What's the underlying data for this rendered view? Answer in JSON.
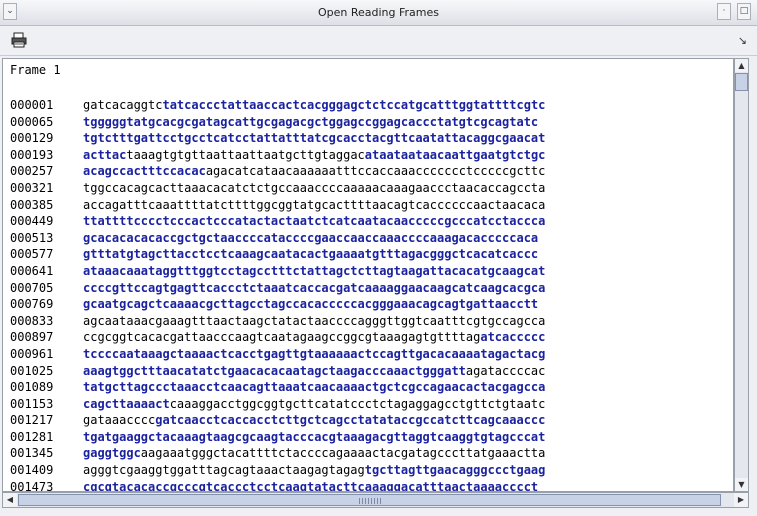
{
  "window": {
    "title": "Open Reading Frames"
  },
  "icons": {
    "print": "printer-icon",
    "corner": "resize-corner-icon"
  },
  "frame_label": "Frame 1",
  "colors": {
    "orf_highlight": "#1a22a0"
  },
  "rows": [
    {
      "pos": "000001",
      "seq": [
        {
          "t": "gatcacaggtc",
          "h": false
        },
        {
          "t": "tatcaccctattaaccactcacgggagctctccatgcatttggtattttcgtc",
          "h": true
        }
      ]
    },
    {
      "pos": "000065",
      "seq": [
        {
          "t": "tgggggtatgcacgcgatagcattgcgagacgctggagccggagcaccctatgtcgcagtatc",
          "h": true
        }
      ]
    },
    {
      "pos": "000129",
      "seq": [
        {
          "t": "tgtctttgattcctgcctcatcctattatttatcgcacctacgttcaatattacaggcgaacat",
          "h": true
        }
      ]
    },
    {
      "pos": "000193",
      "seq": [
        {
          "t": "acttac",
          "h": true
        },
        {
          "t": "taaagtgtgttaattaattaatgcttgtaggac",
          "h": false
        },
        {
          "t": "ataataataacaattgaatgtctgc",
          "h": true
        }
      ]
    },
    {
      "pos": "000257",
      "seq": [
        {
          "t": "acagccactttccacac",
          "h": true
        },
        {
          "t": "agacatcataacaaaaaatttccaccaaaccccccctcccccgcttc",
          "h": false
        }
      ]
    },
    {
      "pos": "000321",
      "seq": [
        {
          "t": "tggccacagcacttaaacacatctctgccaaaccccaaaaacaaagaaccctaacaccagccta",
          "h": false
        }
      ]
    },
    {
      "pos": "000385",
      "seq": [
        {
          "t": "accagatttcaaattttatcttttggcggtatgcacttttaacagtcaccccccaactaacaca",
          "h": false
        }
      ]
    },
    {
      "pos": "000449",
      "seq": [
        {
          "t": "ttattttcccctcccactcccatactactaatctcatcaatacaacccccgcccatcctaccca",
          "h": true
        }
      ]
    },
    {
      "pos": "000513",
      "seq": [
        {
          "t": "gcacacacacaccgctgctaaccccataccccgaaccaaccaaaccccaaagacacccccaca",
          "h": true
        }
      ]
    },
    {
      "pos": "000577",
      "seq": [
        {
          "t": "gtttatgtagcttacctcctcaaagcaatacactgaaaatgtttagacgggctcacatcaccc",
          "h": true
        }
      ]
    },
    {
      "pos": "000641",
      "seq": [
        {
          "t": "ataaacaaataggtttggtcctagcctttctattagctcttagtaagattacacatgcaagcat",
          "h": true
        }
      ]
    },
    {
      "pos": "000705",
      "seq": [
        {
          "t": "ccccgttccagtgagttcaccctctaaatcaccacgatcaaaaggaacaagcatcaagcacgca",
          "h": true
        }
      ]
    },
    {
      "pos": "000769",
      "seq": [
        {
          "t": "gcaatgcagctcaaaacgcttagcctagccacacccccacgggaaacagcagtgattaacctt",
          "h": true
        }
      ]
    },
    {
      "pos": "000833",
      "seq": [
        {
          "t": "agcaataaacgaaagtttaactaagctatactaaccccagggttggtcaatttcgtgccagcca",
          "h": false
        }
      ]
    },
    {
      "pos": "000897",
      "seq": [
        {
          "t": "ccgcggtcacacgattaacccaagtcaatagaagccggcgtaaagagtgttttag",
          "h": false
        },
        {
          "t": "atcaccccc",
          "h": true
        }
      ]
    },
    {
      "pos": "000961",
      "seq": [
        {
          "t": "tccccaataaagctaaaactcacctgagttgtaaaaaactccagttgacacaaaatagactacg",
          "h": true
        }
      ]
    },
    {
      "pos": "001025",
      "seq": [
        {
          "t": "aaagtggctttaacatatctgaacacacaatagctaagacccaaactgggatt",
          "h": true
        },
        {
          "t": "agataccccac",
          "h": false
        }
      ]
    },
    {
      "pos": "001089",
      "seq": [
        {
          "t": "tatgcttagccctaaacctcaacagttaaatcaacaaaactgctcgccagaacactacgagcca",
          "h": true
        }
      ]
    },
    {
      "pos": "001153",
      "seq": [
        {
          "t": "cagcttaaaact",
          "h": true
        },
        {
          "t": "caaaggacctggcggtgcttcatatccctctagaggagcctgttctgtaatc",
          "h": false
        }
      ]
    },
    {
      "pos": "001217",
      "seq": [
        {
          "t": "gataaacccc",
          "h": false
        },
        {
          "t": "gatcaacctcaccacctcttgctcagcctatataccgccatcttcagcaaaccc",
          "h": true
        }
      ]
    },
    {
      "pos": "001281",
      "seq": [
        {
          "t": "tgatgaaggctacaaagtaagcgcaagtacccacgtaaagacgttaggtcaaggtgtagcccat",
          "h": true
        }
      ]
    },
    {
      "pos": "001345",
      "seq": [
        {
          "t": "gaggtggc",
          "h": true
        },
        {
          "t": "aagaaatgggctacattttctaccccagaaaactacgatagcccttatgaaactta",
          "h": false
        }
      ]
    },
    {
      "pos": "001409",
      "seq": [
        {
          "t": "agggtcgaaggtggatttagcagtaaactaagagtagag",
          "h": false
        },
        {
          "t": "tgcttagttgaacagggccctgaag",
          "h": true
        }
      ]
    },
    {
      "pos": "001473",
      "seq": [
        {
          "t": "cgcgtacacaccgcccgtcaccctcctcaagtatacttcaaaggacatttaactaaaacccct",
          "h": true
        }
      ]
    }
  ]
}
